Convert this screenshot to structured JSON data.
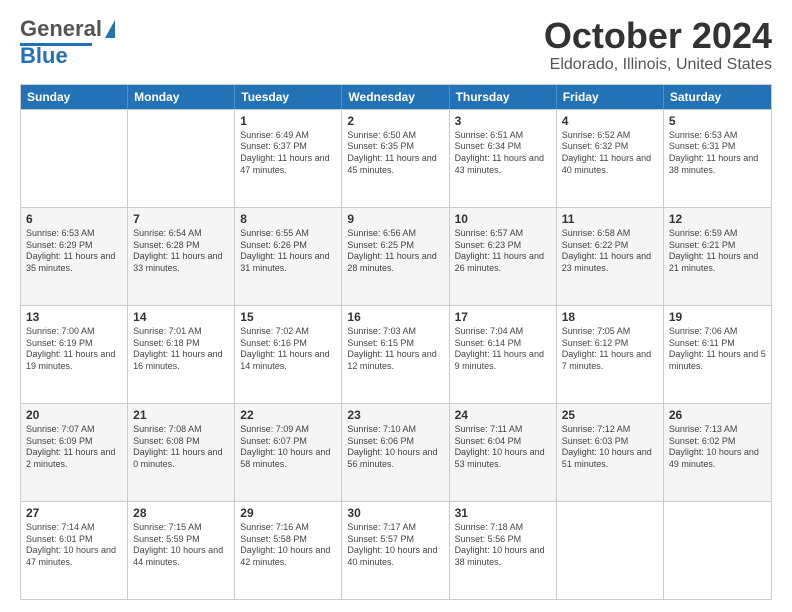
{
  "header": {
    "logo_general": "General",
    "logo_blue": "Blue",
    "title": "October 2024",
    "subtitle": "Eldorado, Illinois, United States"
  },
  "calendar": {
    "days_of_week": [
      "Sunday",
      "Monday",
      "Tuesday",
      "Wednesday",
      "Thursday",
      "Friday",
      "Saturday"
    ],
    "weeks": [
      [
        {
          "day": "",
          "info": "",
          "shaded": false
        },
        {
          "day": "",
          "info": "",
          "shaded": false
        },
        {
          "day": "1",
          "info": "Sunrise: 6:49 AM\nSunset: 6:37 PM\nDaylight: 11 hours and 47 minutes.",
          "shaded": false
        },
        {
          "day": "2",
          "info": "Sunrise: 6:50 AM\nSunset: 6:35 PM\nDaylight: 11 hours and 45 minutes.",
          "shaded": false
        },
        {
          "day": "3",
          "info": "Sunrise: 6:51 AM\nSunset: 6:34 PM\nDaylight: 11 hours and 43 minutes.",
          "shaded": false
        },
        {
          "day": "4",
          "info": "Sunrise: 6:52 AM\nSunset: 6:32 PM\nDaylight: 11 hours and 40 minutes.",
          "shaded": false
        },
        {
          "day": "5",
          "info": "Sunrise: 6:53 AM\nSunset: 6:31 PM\nDaylight: 11 hours and 38 minutes.",
          "shaded": false
        }
      ],
      [
        {
          "day": "6",
          "info": "Sunrise: 6:53 AM\nSunset: 6:29 PM\nDaylight: 11 hours and 35 minutes.",
          "shaded": true
        },
        {
          "day": "7",
          "info": "Sunrise: 6:54 AM\nSunset: 6:28 PM\nDaylight: 11 hours and 33 minutes.",
          "shaded": true
        },
        {
          "day": "8",
          "info": "Sunrise: 6:55 AM\nSunset: 6:26 PM\nDaylight: 11 hours and 31 minutes.",
          "shaded": true
        },
        {
          "day": "9",
          "info": "Sunrise: 6:56 AM\nSunset: 6:25 PM\nDaylight: 11 hours and 28 minutes.",
          "shaded": true
        },
        {
          "day": "10",
          "info": "Sunrise: 6:57 AM\nSunset: 6:23 PM\nDaylight: 11 hours and 26 minutes.",
          "shaded": true
        },
        {
          "day": "11",
          "info": "Sunrise: 6:58 AM\nSunset: 6:22 PM\nDaylight: 11 hours and 23 minutes.",
          "shaded": true
        },
        {
          "day": "12",
          "info": "Sunrise: 6:59 AM\nSunset: 6:21 PM\nDaylight: 11 hours and 21 minutes.",
          "shaded": true
        }
      ],
      [
        {
          "day": "13",
          "info": "Sunrise: 7:00 AM\nSunset: 6:19 PM\nDaylight: 11 hours and 19 minutes.",
          "shaded": false
        },
        {
          "day": "14",
          "info": "Sunrise: 7:01 AM\nSunset: 6:18 PM\nDaylight: 11 hours and 16 minutes.",
          "shaded": false
        },
        {
          "day": "15",
          "info": "Sunrise: 7:02 AM\nSunset: 6:16 PM\nDaylight: 11 hours and 14 minutes.",
          "shaded": false
        },
        {
          "day": "16",
          "info": "Sunrise: 7:03 AM\nSunset: 6:15 PM\nDaylight: 11 hours and 12 minutes.",
          "shaded": false
        },
        {
          "day": "17",
          "info": "Sunrise: 7:04 AM\nSunset: 6:14 PM\nDaylight: 11 hours and 9 minutes.",
          "shaded": false
        },
        {
          "day": "18",
          "info": "Sunrise: 7:05 AM\nSunset: 6:12 PM\nDaylight: 11 hours and 7 minutes.",
          "shaded": false
        },
        {
          "day": "19",
          "info": "Sunrise: 7:06 AM\nSunset: 6:11 PM\nDaylight: 11 hours and 5 minutes.",
          "shaded": false
        }
      ],
      [
        {
          "day": "20",
          "info": "Sunrise: 7:07 AM\nSunset: 6:09 PM\nDaylight: 11 hours and 2 minutes.",
          "shaded": true
        },
        {
          "day": "21",
          "info": "Sunrise: 7:08 AM\nSunset: 6:08 PM\nDaylight: 11 hours and 0 minutes.",
          "shaded": true
        },
        {
          "day": "22",
          "info": "Sunrise: 7:09 AM\nSunset: 6:07 PM\nDaylight: 10 hours and 58 minutes.",
          "shaded": true
        },
        {
          "day": "23",
          "info": "Sunrise: 7:10 AM\nSunset: 6:06 PM\nDaylight: 10 hours and 56 minutes.",
          "shaded": true
        },
        {
          "day": "24",
          "info": "Sunrise: 7:11 AM\nSunset: 6:04 PM\nDaylight: 10 hours and 53 minutes.",
          "shaded": true
        },
        {
          "day": "25",
          "info": "Sunrise: 7:12 AM\nSunset: 6:03 PM\nDaylight: 10 hours and 51 minutes.",
          "shaded": true
        },
        {
          "day": "26",
          "info": "Sunrise: 7:13 AM\nSunset: 6:02 PM\nDaylight: 10 hours and 49 minutes.",
          "shaded": true
        }
      ],
      [
        {
          "day": "27",
          "info": "Sunrise: 7:14 AM\nSunset: 6:01 PM\nDaylight: 10 hours and 47 minutes.",
          "shaded": false
        },
        {
          "day": "28",
          "info": "Sunrise: 7:15 AM\nSunset: 5:59 PM\nDaylight: 10 hours and 44 minutes.",
          "shaded": false
        },
        {
          "day": "29",
          "info": "Sunrise: 7:16 AM\nSunset: 5:58 PM\nDaylight: 10 hours and 42 minutes.",
          "shaded": false
        },
        {
          "day": "30",
          "info": "Sunrise: 7:17 AM\nSunset: 5:57 PM\nDaylight: 10 hours and 40 minutes.",
          "shaded": false
        },
        {
          "day": "31",
          "info": "Sunrise: 7:18 AM\nSunset: 5:56 PM\nDaylight: 10 hours and 38 minutes.",
          "shaded": false
        },
        {
          "day": "",
          "info": "",
          "shaded": false
        },
        {
          "day": "",
          "info": "",
          "shaded": false
        }
      ]
    ]
  }
}
